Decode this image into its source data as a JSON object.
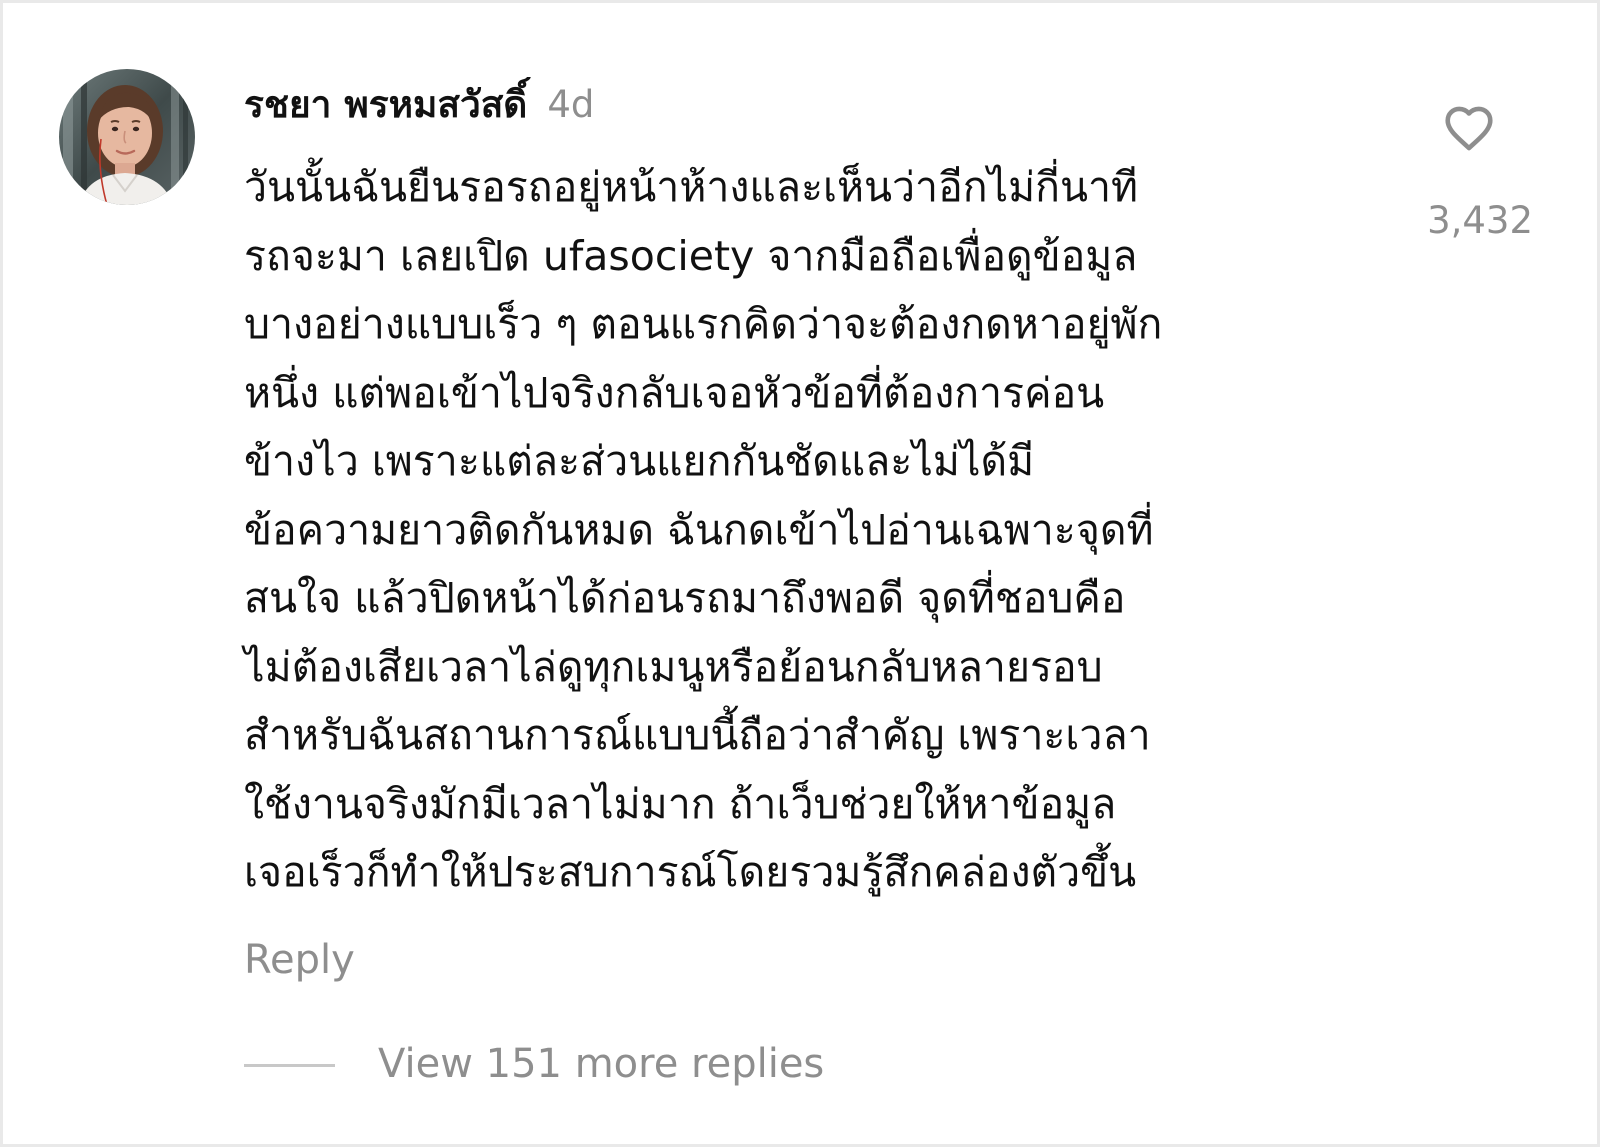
{
  "comment": {
    "username": "รชยา พรหมสวัสดิ์",
    "time_ago": "4d",
    "lines": [
      "วันนั้นฉันยืนรอรถอยู่หน้าห้างและเห็นว่าอีกไม่กี่นาที",
      "รถจะมา เลยเปิด ufasociety จากมือถือเพื่อดูข้อมูล",
      "บางอย่างแบบเร็ว ๆ ตอนแรกคิดว่าจะต้องกดหาอยู่พัก",
      "หนึ่ง แต่พอเข้าไปจริงกลับเจอหัวข้อที่ต้องการค่อน",
      "ข้างไว เพราะแต่ละส่วนแยกกันชัดและไม่ได้มี",
      "ข้อความยาวติดกันหมด ฉันกดเข้าไปอ่านเฉพาะจุดที่",
      "สนใจ แล้วปิดหน้าได้ก่อนรถมาถึงพอดี จุดที่ชอบคือ",
      "ไม่ต้องเสียเวลาไล่ดูทุกเมนูหรือย้อนกลับหลายรอบ",
      "สำหรับฉันสถานการณ์แบบนี้ถือว่าสำคัญ เพราะเวลา",
      "ใช้งานจริงมักมีเวลาไม่มาก ถ้าเว็บช่วยให้หาข้อมูล",
      "เจอเร็วก็ทำให้ประสบการณ์โดยรวมรู้สึกคล่องตัวขึ้น"
    ],
    "like_icon": "heart-outline-icon",
    "like_count": "3,432",
    "reply_label": "Reply",
    "view_replies_label": "View 151 more replies"
  },
  "colors": {
    "text_primary": "#111111",
    "text_secondary": "#8e8e8e",
    "divider": "#c8c8c8"
  }
}
